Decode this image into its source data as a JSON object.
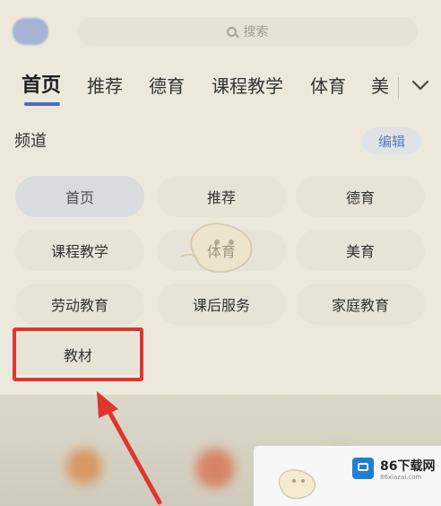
{
  "search": {
    "placeholder": "搜索"
  },
  "tabs": [
    {
      "label": "首页",
      "active": true
    },
    {
      "label": "推荐"
    },
    {
      "label": "德育"
    },
    {
      "label": "课程教学"
    },
    {
      "label": "体育"
    },
    {
      "label": "美"
    }
  ],
  "channels": {
    "title": "频道",
    "edit_label": "编辑",
    "items": [
      {
        "label": "首页",
        "selected": true
      },
      {
        "label": "推荐"
      },
      {
        "label": "德育"
      },
      {
        "label": "课程教学"
      },
      {
        "label": "体育"
      },
      {
        "label": "美育"
      },
      {
        "label": "劳动教育"
      },
      {
        "label": "课后服务"
      },
      {
        "label": "家庭教育"
      },
      {
        "label": "教材"
      }
    ]
  },
  "watermark": {
    "brand": "86下载网",
    "url": "86xiazai.com"
  },
  "colors": {
    "accent": "#4a6cc2",
    "highlight": "#e03530",
    "background": "#ece9dc"
  },
  "icons": [
    "search-icon",
    "chevron-down-icon",
    "arrow-annotation"
  ]
}
